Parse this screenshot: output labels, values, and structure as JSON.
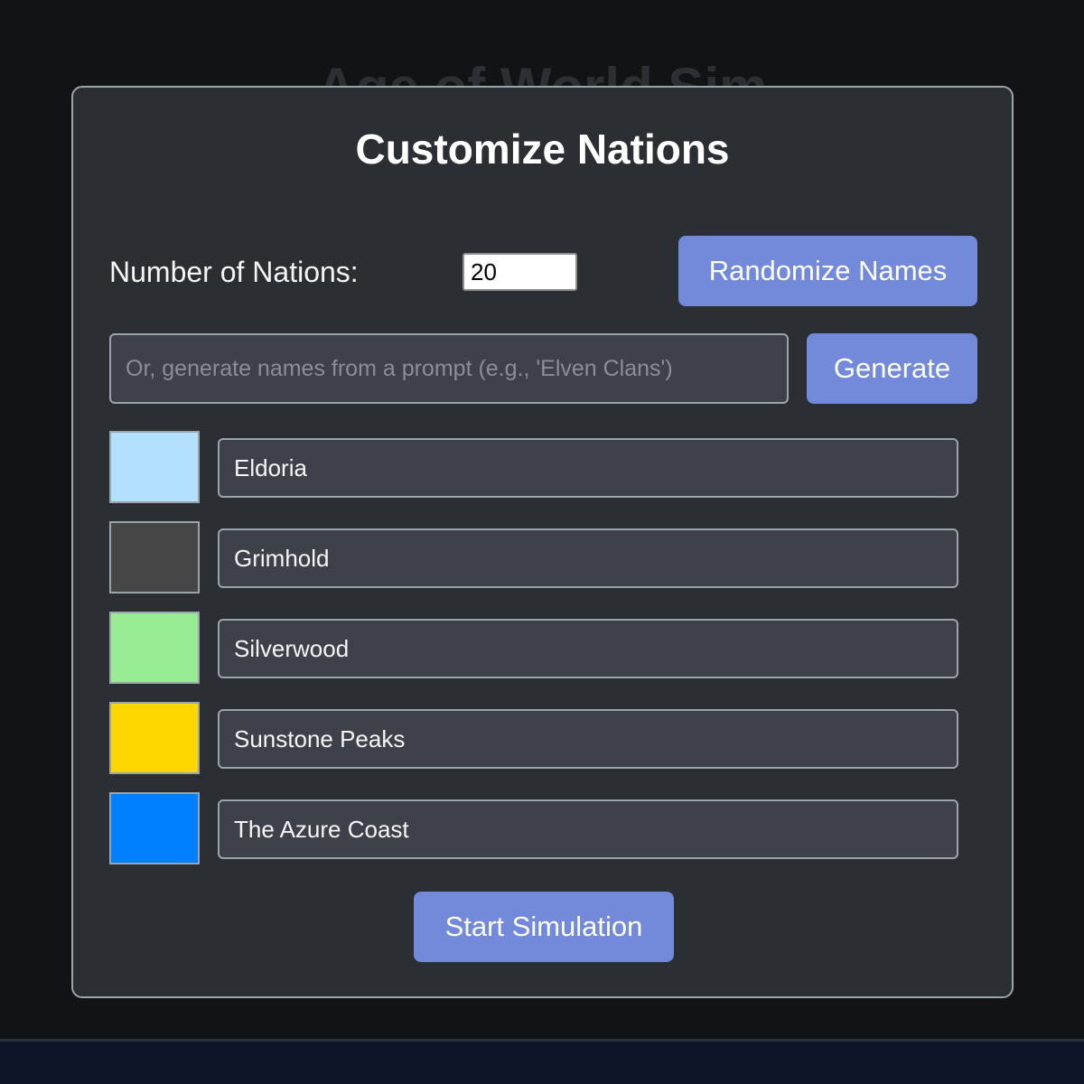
{
  "background": {
    "title": "Age of World Sim"
  },
  "modal": {
    "title": "Customize Nations",
    "count_label": "Number of Nations:",
    "count_value": "20",
    "randomize_label": "Randomize Names",
    "prompt_placeholder": "Or, generate names from a prompt (e.g., 'Elven Clans')",
    "prompt_value": "",
    "generate_label": "Generate",
    "start_label": "Start Simulation"
  },
  "nations": [
    {
      "name": "Eldoria",
      "color": "#b3e0ff"
    },
    {
      "name": "Grimhold",
      "color": "#464646"
    },
    {
      "name": "Silverwood",
      "color": "#98ec94"
    },
    {
      "name": "Sunstone Peaks",
      "color": "#ffd700"
    },
    {
      "name": "The Azure Coast",
      "color": "#0080ff"
    }
  ],
  "colors": {
    "accent": "#7389d9",
    "modal_bg": "#2b2e33",
    "page_bg": "#121315"
  }
}
